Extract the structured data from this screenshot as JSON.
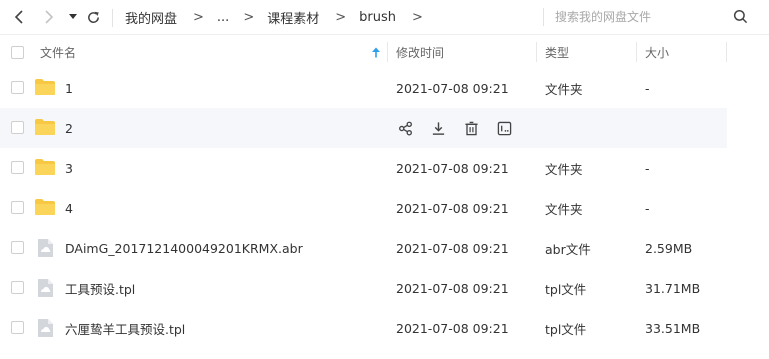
{
  "nav": {
    "breadcrumbs": [
      "我的网盘",
      "...",
      "课程素材",
      "brush"
    ],
    "search_placeholder": "搜索我的网盘文件"
  },
  "table": {
    "columns": {
      "name": "文件名",
      "modified": "修改时间",
      "type": "类型",
      "size": "大小"
    },
    "rows": [
      {
        "name": "1",
        "modified": "2021-07-08 09:21",
        "type": "文件夹",
        "size": "-",
        "icon": "folder-icon"
      },
      {
        "name": "2",
        "modified": "",
        "type": "",
        "size": "",
        "icon": "folder-icon"
      },
      {
        "name": "3",
        "modified": "2021-07-08 09:21",
        "type": "文件夹",
        "size": "-",
        "icon": "folder-icon"
      },
      {
        "name": "4",
        "modified": "2021-07-08 09:21",
        "type": "文件夹",
        "size": "-",
        "icon": "folder-icon"
      },
      {
        "name": "DAimG_2017121400049201KRMX.abr",
        "modified": "2021-07-08 09:21",
        "type": "abr文件",
        "size": "2.59MB",
        "icon": "file-icon"
      },
      {
        "name": "工具预设.tpl",
        "modified": "2021-07-08 09:21",
        "type": "tpl文件",
        "size": "31.71MB",
        "icon": "file-icon"
      },
      {
        "name": "六厘鸷羊工具预设.tpl",
        "modified": "2021-07-08 09:21",
        "type": "tpl文件",
        "size": "33.51MB",
        "icon": "file-icon"
      }
    ]
  },
  "colors": {
    "folder": "#f7c844",
    "accent": "#2f9fea",
    "file": "#c9ccd1"
  }
}
